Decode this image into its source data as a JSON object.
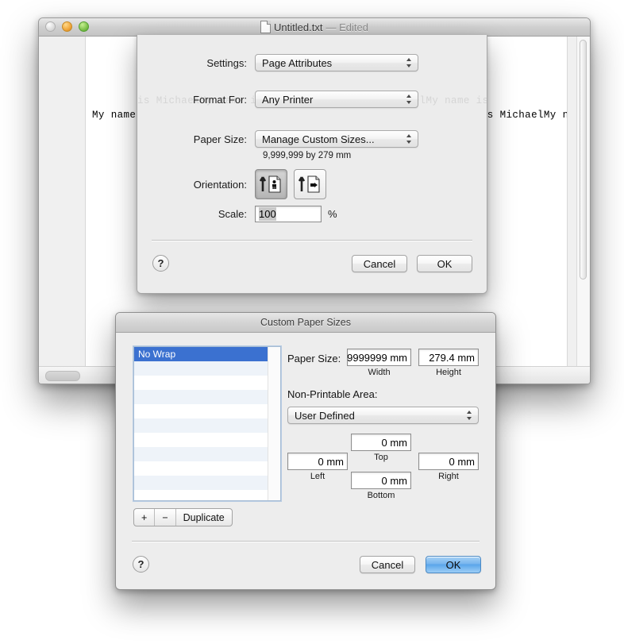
{
  "window": {
    "title": "Untitled.txt",
    "status": "— Edited",
    "document_text": "My name is MichaelMy name is MichaelMy name is MichaelMy name is MichaelMy name is MichaelMy name is Mic",
    "ghost_text": "is MichaelMy name is MichaelMy name is MichaelMy name is Michael"
  },
  "page_setup": {
    "settings_label": "Settings:",
    "settings_value": "Page Attributes",
    "format_for_label": "Format For:",
    "format_for_value": "Any Printer",
    "paper_size_label": "Paper Size:",
    "paper_size_value": "Manage Custom Sizes...",
    "paper_size_dimensions": "9,999,999 by 279 mm",
    "orientation_label": "Orientation:",
    "scale_label": "Scale:",
    "scale_value": "100",
    "scale_unit": "%",
    "help_label": "?",
    "cancel_label": "Cancel",
    "ok_label": "OK"
  },
  "custom_sizes": {
    "title": "Custom Paper Sizes",
    "list_items": [
      "No Wrap"
    ],
    "add_label": "+",
    "remove_label": "−",
    "duplicate_label": "Duplicate",
    "paper_size_label": "Paper Size:",
    "width_value": "9999999 mm",
    "width_caption": "Width",
    "height_value": "279.4 mm",
    "height_caption": "Height",
    "non_printable_label": "Non-Printable Area:",
    "non_printable_value": "User Defined",
    "top_value": "0 mm",
    "top_caption": "Top",
    "left_value": "0 mm",
    "left_caption": "Left",
    "right_value": "0 mm",
    "right_caption": "Right",
    "bottom_value": "0 mm",
    "bottom_caption": "Bottom",
    "help_label": "?",
    "cancel_label": "Cancel",
    "ok_label": "OK"
  },
  "colors": {
    "selection_blue": "#3b71d0",
    "default_button_blue": "#5aa5ea"
  }
}
